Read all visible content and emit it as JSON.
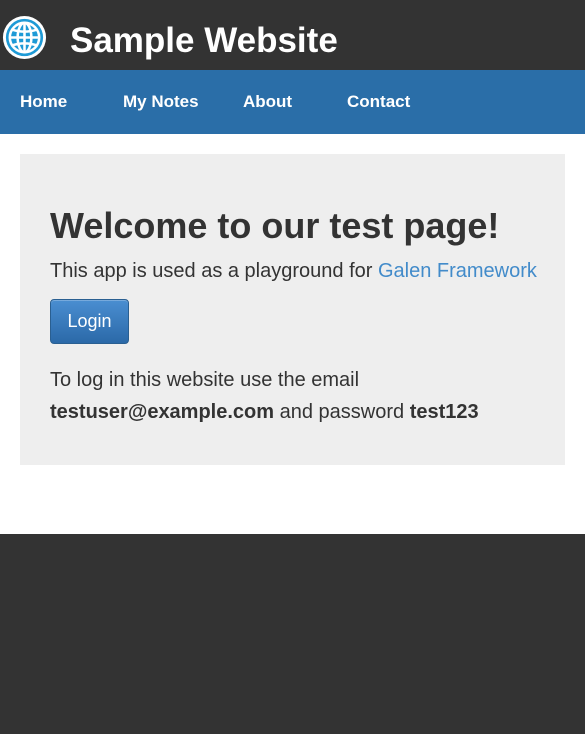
{
  "header": {
    "title": "Sample Website",
    "logo_icon": "globe-icon",
    "logo_color": "#1e9ad6"
  },
  "nav": {
    "background": "#2a6ea8",
    "items": [
      {
        "label": "Home"
      },
      {
        "label": "My Notes"
      },
      {
        "label": "About"
      },
      {
        "label": "Contact"
      }
    ]
  },
  "main": {
    "heading": "Welcome to our test page!",
    "intro_text": "This app is used as a playground for ",
    "intro_link": "Galen Framework",
    "link_color": "#428bca",
    "login_button": "Login",
    "info_text_1": "To log in this website use the email",
    "email": "testuser@example.com",
    "info_text_2": " and password ",
    "password": "test123"
  }
}
